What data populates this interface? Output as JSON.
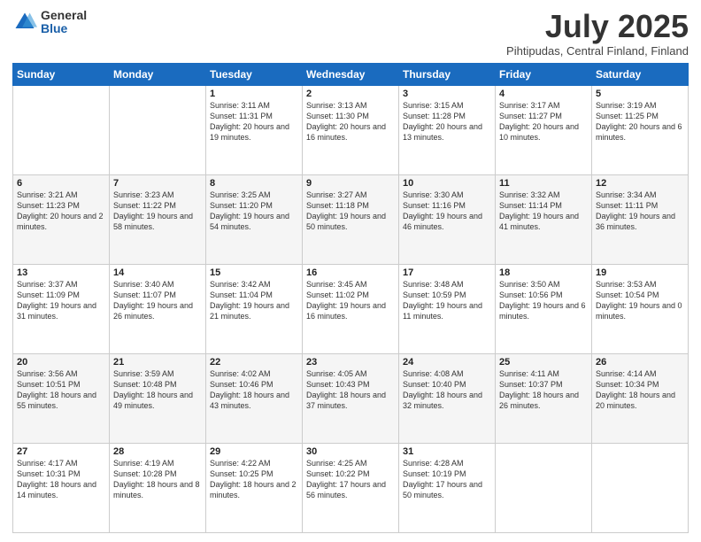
{
  "header": {
    "logo": {
      "general": "General",
      "blue": "Blue"
    },
    "title": "July 2025",
    "subtitle": "Pihtipudas, Central Finland, Finland"
  },
  "calendar": {
    "headers": [
      "Sunday",
      "Monday",
      "Tuesday",
      "Wednesday",
      "Thursday",
      "Friday",
      "Saturday"
    ],
    "rows": [
      [
        {
          "day": "",
          "info": ""
        },
        {
          "day": "",
          "info": ""
        },
        {
          "day": "1",
          "info": "Sunrise: 3:11 AM\nSunset: 11:31 PM\nDaylight: 20 hours\nand 19 minutes."
        },
        {
          "day": "2",
          "info": "Sunrise: 3:13 AM\nSunset: 11:30 PM\nDaylight: 20 hours\nand 16 minutes."
        },
        {
          "day": "3",
          "info": "Sunrise: 3:15 AM\nSunset: 11:28 PM\nDaylight: 20 hours\nand 13 minutes."
        },
        {
          "day": "4",
          "info": "Sunrise: 3:17 AM\nSunset: 11:27 PM\nDaylight: 20 hours\nand 10 minutes."
        },
        {
          "day": "5",
          "info": "Sunrise: 3:19 AM\nSunset: 11:25 PM\nDaylight: 20 hours\nand 6 minutes."
        }
      ],
      [
        {
          "day": "6",
          "info": "Sunrise: 3:21 AM\nSunset: 11:23 PM\nDaylight: 20 hours\nand 2 minutes."
        },
        {
          "day": "7",
          "info": "Sunrise: 3:23 AM\nSunset: 11:22 PM\nDaylight: 19 hours\nand 58 minutes."
        },
        {
          "day": "8",
          "info": "Sunrise: 3:25 AM\nSunset: 11:20 PM\nDaylight: 19 hours\nand 54 minutes."
        },
        {
          "day": "9",
          "info": "Sunrise: 3:27 AM\nSunset: 11:18 PM\nDaylight: 19 hours\nand 50 minutes."
        },
        {
          "day": "10",
          "info": "Sunrise: 3:30 AM\nSunset: 11:16 PM\nDaylight: 19 hours\nand 46 minutes."
        },
        {
          "day": "11",
          "info": "Sunrise: 3:32 AM\nSunset: 11:14 PM\nDaylight: 19 hours\nand 41 minutes."
        },
        {
          "day": "12",
          "info": "Sunrise: 3:34 AM\nSunset: 11:11 PM\nDaylight: 19 hours\nand 36 minutes."
        }
      ],
      [
        {
          "day": "13",
          "info": "Sunrise: 3:37 AM\nSunset: 11:09 PM\nDaylight: 19 hours\nand 31 minutes."
        },
        {
          "day": "14",
          "info": "Sunrise: 3:40 AM\nSunset: 11:07 PM\nDaylight: 19 hours\nand 26 minutes."
        },
        {
          "day": "15",
          "info": "Sunrise: 3:42 AM\nSunset: 11:04 PM\nDaylight: 19 hours\nand 21 minutes."
        },
        {
          "day": "16",
          "info": "Sunrise: 3:45 AM\nSunset: 11:02 PM\nDaylight: 19 hours\nand 16 minutes."
        },
        {
          "day": "17",
          "info": "Sunrise: 3:48 AM\nSunset: 10:59 PM\nDaylight: 19 hours\nand 11 minutes."
        },
        {
          "day": "18",
          "info": "Sunrise: 3:50 AM\nSunset: 10:56 PM\nDaylight: 19 hours\nand 6 minutes."
        },
        {
          "day": "19",
          "info": "Sunrise: 3:53 AM\nSunset: 10:54 PM\nDaylight: 19 hours\nand 0 minutes."
        }
      ],
      [
        {
          "day": "20",
          "info": "Sunrise: 3:56 AM\nSunset: 10:51 PM\nDaylight: 18 hours\nand 55 minutes."
        },
        {
          "day": "21",
          "info": "Sunrise: 3:59 AM\nSunset: 10:48 PM\nDaylight: 18 hours\nand 49 minutes."
        },
        {
          "day": "22",
          "info": "Sunrise: 4:02 AM\nSunset: 10:46 PM\nDaylight: 18 hours\nand 43 minutes."
        },
        {
          "day": "23",
          "info": "Sunrise: 4:05 AM\nSunset: 10:43 PM\nDaylight: 18 hours\nand 37 minutes."
        },
        {
          "day": "24",
          "info": "Sunrise: 4:08 AM\nSunset: 10:40 PM\nDaylight: 18 hours\nand 32 minutes."
        },
        {
          "day": "25",
          "info": "Sunrise: 4:11 AM\nSunset: 10:37 PM\nDaylight: 18 hours\nand 26 minutes."
        },
        {
          "day": "26",
          "info": "Sunrise: 4:14 AM\nSunset: 10:34 PM\nDaylight: 18 hours\nand 20 minutes."
        }
      ],
      [
        {
          "day": "27",
          "info": "Sunrise: 4:17 AM\nSunset: 10:31 PM\nDaylight: 18 hours\nand 14 minutes."
        },
        {
          "day": "28",
          "info": "Sunrise: 4:19 AM\nSunset: 10:28 PM\nDaylight: 18 hours\nand 8 minutes."
        },
        {
          "day": "29",
          "info": "Sunrise: 4:22 AM\nSunset: 10:25 PM\nDaylight: 18 hours\nand 2 minutes."
        },
        {
          "day": "30",
          "info": "Sunrise: 4:25 AM\nSunset: 10:22 PM\nDaylight: 17 hours\nand 56 minutes."
        },
        {
          "day": "31",
          "info": "Sunrise: 4:28 AM\nSunset: 10:19 PM\nDaylight: 17 hours\nand 50 minutes."
        },
        {
          "day": "",
          "info": ""
        },
        {
          "day": "",
          "info": ""
        }
      ]
    ]
  }
}
